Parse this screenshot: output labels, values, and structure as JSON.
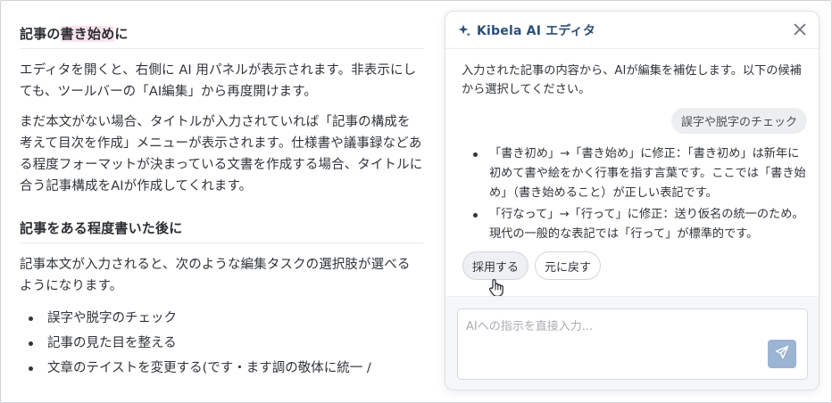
{
  "article": {
    "heading1": {
      "prefix": "記事の",
      "highlight": "書き始め",
      "suffix": "に"
    },
    "para1": "エディタを開くと、右側に AI 用パネルが表示されます。非表示にしても、ツールバーの「AI編集」から再度開けます。",
    "para2": "まだ本文がない場合、タイトルが入力されていれば「記事の構成を考えて目次を作成」メニューが表示されます。仕様書や議事録などある程度フォーマットが決まっている文書を作成する場合、タイトルに合う記事構成をAIが作成してくれます。",
    "heading2": "記事をある程度書いた後に",
    "para3": "記事本文が入力されると、次のような編集タスクの選択肢が選べるようになります。",
    "list": [
      "誤字や脱字のチェック",
      "記事の見た目を整える",
      "文章のテイストを変更する(です・ます調の敬体に統一 /"
    ]
  },
  "panel": {
    "title": "Kibela AI エディタ",
    "intro": "入力された記事の内容から、AIが編集を補佐します。以下の候補から選択してください。",
    "user_choice": "誤字や脱字のチェック",
    "suggestions": [
      "「書き初め」→「書き始め」に修正：「書き初め」は新年に初めて書や絵をかく行事を指す言葉です。ここでは「書き始め」（書き始めること）が正しい表記です。",
      "「行なって」→「行って」に修正：送り仮名の統一のため。現代の一般的な表記では「行って」が標準的です。"
    ],
    "adopt_label": "採用する",
    "revert_label": "元に戻す",
    "input_placeholder": "AIへの指示を直接入力...",
    "icons": {
      "title": "sparkle-icon",
      "close": "close-icon",
      "send": "send-icon",
      "cursor": "hand-pointer-icon"
    },
    "colors": {
      "title": "#2b4f7a",
      "send_button": "#9bb4d3",
      "highlight": "#fbe3ec"
    }
  }
}
